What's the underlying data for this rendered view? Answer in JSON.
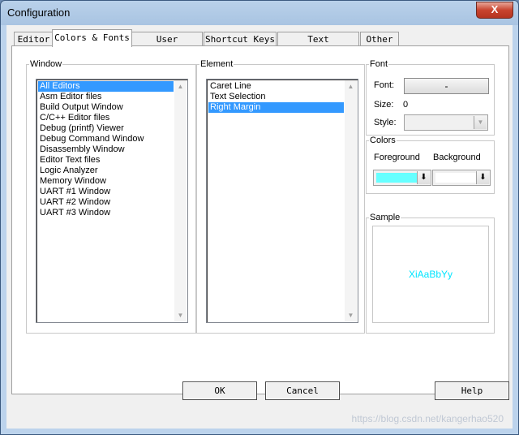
{
  "window": {
    "title": "Configuration",
    "close_glyph": "X"
  },
  "tabs": [
    "Editor",
    "Colors & Fonts",
    "User Keywords",
    "Shortcut Keys",
    "Text Completion",
    "Other"
  ],
  "active_tab": "Colors & Fonts",
  "window_group": {
    "legend": "Window",
    "items": [
      "All Editors",
      "Asm Editor files",
      "Build Output Window",
      "C/C++ Editor files",
      "Debug (printf) Viewer",
      "Debug Command Window",
      "Disassembly Window",
      "Editor Text files",
      "Logic Analyzer",
      "Memory Window",
      "UART #1 Window",
      "UART #2 Window",
      "UART #3 Window"
    ],
    "selected": "All Editors"
  },
  "element_group": {
    "legend": "Element",
    "items": [
      "Caret Line",
      "Text Selection",
      "Right Margin"
    ],
    "selected": "Right Margin"
  },
  "font_group": {
    "legend": "Font",
    "font_label": "Font:",
    "font_button": "-",
    "size_label": "Size:",
    "size_value": "0",
    "style_label": "Style:"
  },
  "colors_group": {
    "legend": "Colors",
    "foreground_label": "Foreground",
    "background_label": "Background",
    "foreground_color": "#66ffff",
    "background_color": "#ffffff"
  },
  "sample_group": {
    "legend": "Sample",
    "text": "XiAaBbYy",
    "text_color": "#00e5ff"
  },
  "buttons": {
    "ok": "OK",
    "cancel": "Cancel",
    "help": "Help"
  },
  "watermark": "https://blog.csdn.net/kangerhao520"
}
